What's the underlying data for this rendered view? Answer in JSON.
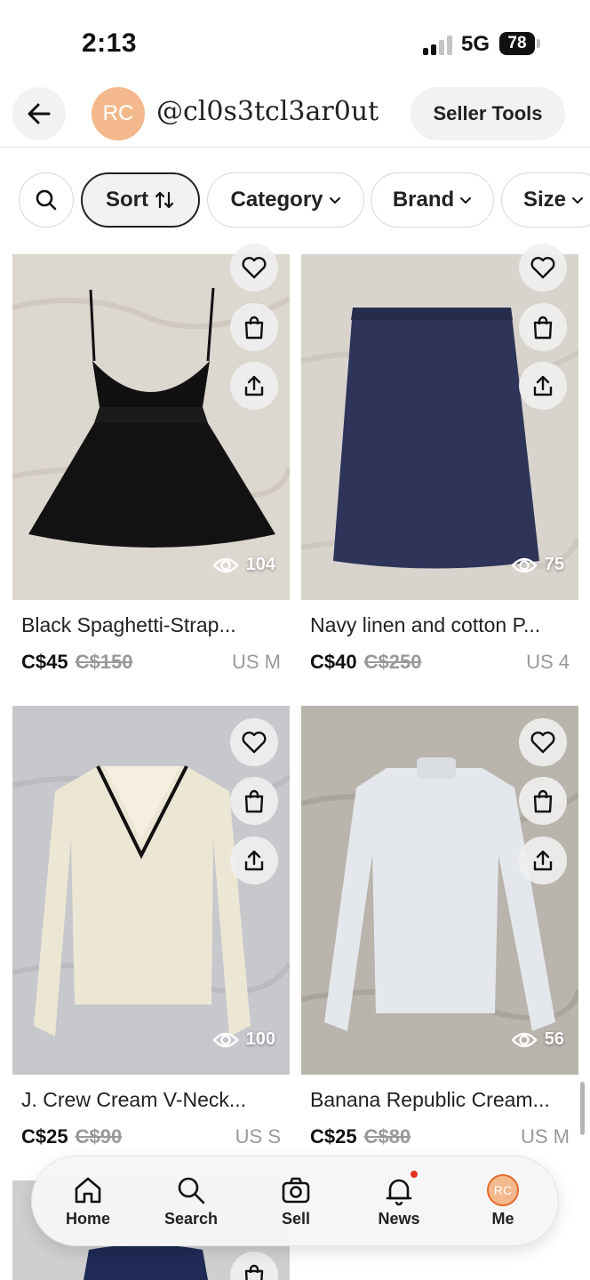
{
  "status_bar": {
    "time": "2:13",
    "network": "5G",
    "battery": "78"
  },
  "header": {
    "avatar_initials": "RC",
    "username": "@cl0s3tcl3ar0ut",
    "seller_tools_label": "Seller Tools"
  },
  "filters": {
    "sort_label": "Sort",
    "chips": [
      "Category",
      "Brand",
      "Size"
    ]
  },
  "listings": [
    {
      "title": "Black Spaghetti-Strap...",
      "price": "C$45",
      "original_price": "C$150",
      "size": "US M",
      "views": "104",
      "image_desc": "black-dress"
    },
    {
      "title": "Navy linen and cotton P...",
      "price": "C$40",
      "original_price": "C$250",
      "size": "US 4",
      "views": "75",
      "image_desc": "navy-skirt"
    },
    {
      "title": "J. Crew Cream V-Neck...",
      "price": "C$25",
      "original_price": "C$90",
      "size": "US S",
      "views": "100",
      "image_desc": "cream-vneck-sweater"
    },
    {
      "title": "Banana Republic Cream...",
      "price": "C$25",
      "original_price": "C$80",
      "size": "US M",
      "views": "56",
      "image_desc": "cream-ribbed-sweater"
    }
  ],
  "tab_bar": {
    "tabs": [
      {
        "label": "Home",
        "icon": "home-icon"
      },
      {
        "label": "Search",
        "icon": "search-icon"
      },
      {
        "label": "Sell",
        "icon": "camera-icon"
      },
      {
        "label": "News",
        "icon": "bell-icon"
      },
      {
        "label": "Me",
        "icon": "avatar"
      }
    ],
    "me_avatar_initials": "RC"
  },
  "colors": {
    "avatar_bg": "#f3b98c",
    "notification_dot": "#e0321e"
  }
}
